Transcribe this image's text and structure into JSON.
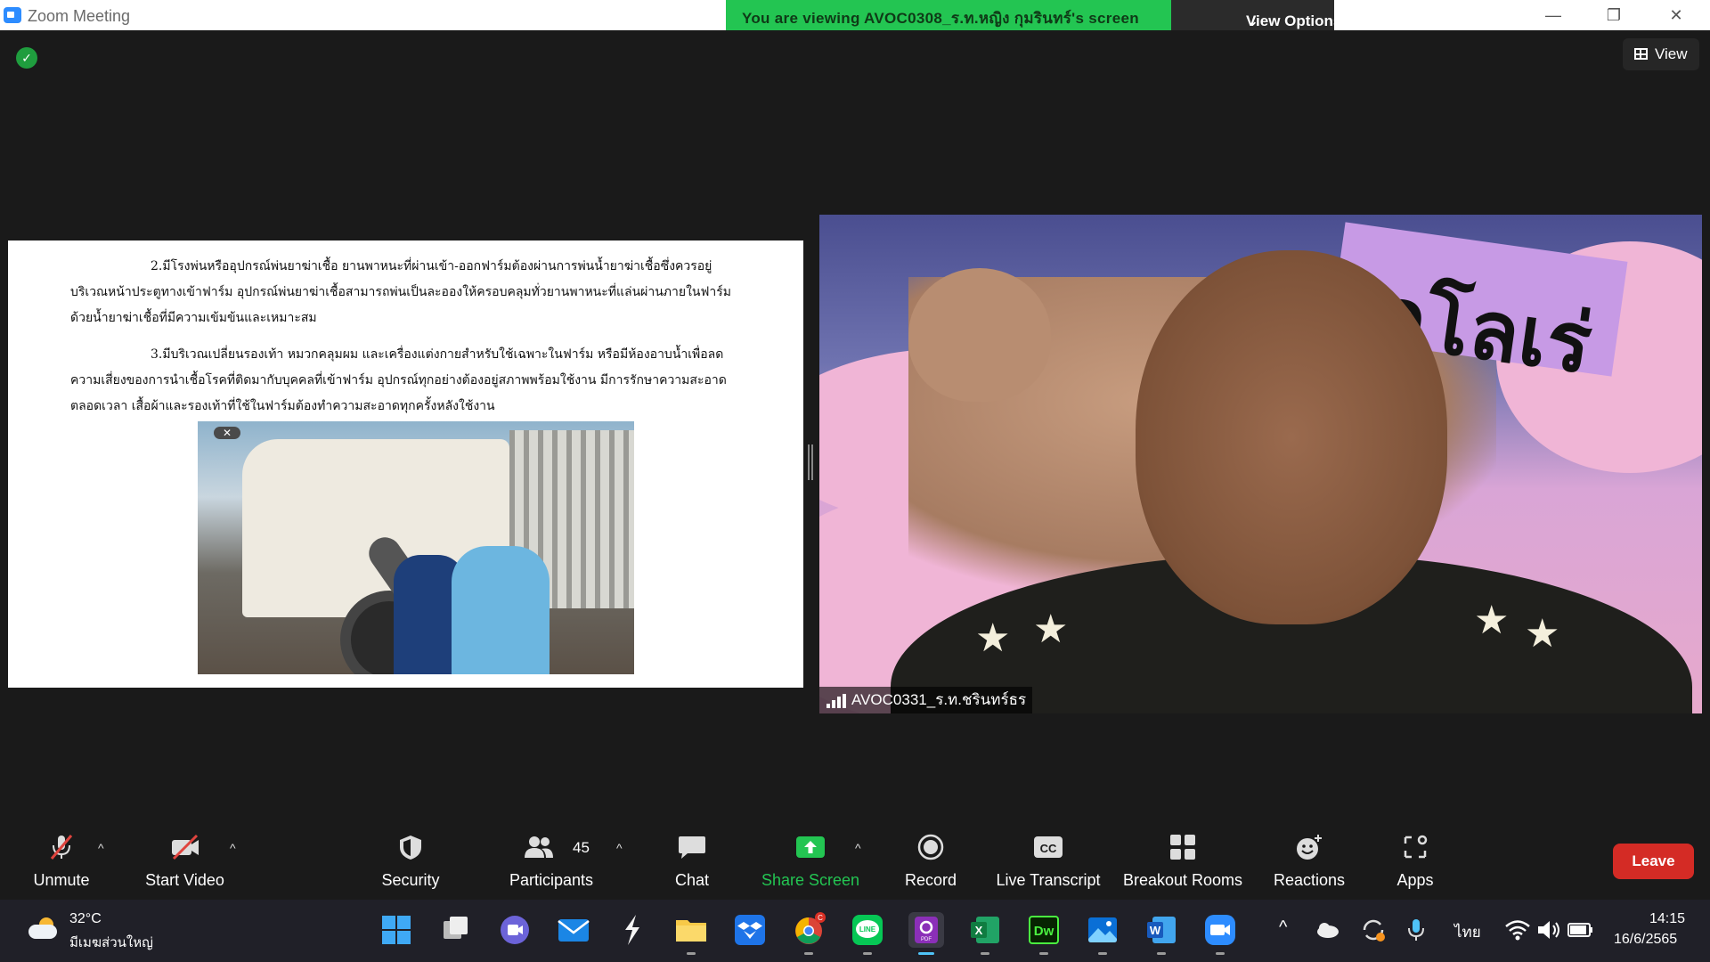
{
  "titlebar": {
    "title": "Zoom Meeting",
    "viewing_banner": "You are viewing AVOC0308_ร.ท.หญิง กุมรินทร์'s screen",
    "view_options": "View Options",
    "minimize": "—",
    "restore": "❐",
    "close": "✕"
  },
  "top": {
    "view_label": "View"
  },
  "document": {
    "lines": [
      "2.มีโรงพ่นหรืออุปกรณ์พ่นยาฆ่าเชื้อ ยานพาหนะที่ผ่านเข้า-ออกฟาร์มต้องผ่านการพ่นน้ำยาฆ่าเชื้อซึ่งควรอยู่",
      "บริเวณหน้าประตูทางเข้าฟาร์ม อุปกรณ์พ่นยาฆ่าเชื้อสามารถพ่นเป็นละอองให้ครอบคลุมทั่วยานพาหนะที่แล่นผ่านภายในฟาร์ม",
      "ด้วยน้ำยาฆ่าเชื้อที่มีความเข้มข้นและเหมาะสม",
      "3.มีบริเวณเปลี่ยนรองเท้า หมวกคลุมผม และเครื่องแต่งกายสำหรับใช้เฉพาะในฟาร์ม หรือมีห้องอาบน้ำเพื่อลด",
      "ความเสี่ยงของการนำเชื้อโรคที่ติดมากับบุคคลที่เข้าฟาร์ม อุปกรณ์ทุกอย่างต้องอยู่สภาพพร้อมใช้งาน มีการรักษาความสะอาด",
      "ตลอดเวลา เสื้อผ้าและรองเท้าที่ใช้ในฟาร์มต้องทำความสะอาดทุกครั้งหลังใช้งาน"
    ]
  },
  "video": {
    "participant_name": "AVOC0331_ร.ท.ชรินทร์ธร",
    "background_text": "กโลเร่"
  },
  "toolbar": {
    "unmute": "Unmute",
    "start_video": "Start Video",
    "security": "Security",
    "participants": "Participants",
    "participant_count": "45",
    "chat": "Chat",
    "share_screen": "Share Screen",
    "record": "Record",
    "live_transcript": "Live Transcript",
    "live_transcript_icon_text": "CC",
    "breakout_rooms": "Breakout Rooms",
    "reactions": "Reactions",
    "apps": "Apps",
    "leave": "Leave",
    "share_color": "#23c552",
    "leave_color": "#d42b25"
  },
  "taskbar": {
    "temperature": "32°C",
    "weather_desc": "มีเมฆส่วนใหญ่",
    "language": "ไทย",
    "time": "14:15",
    "date": "16/6/2565",
    "chrome_badge": "C",
    "dw_label": "Dw",
    "word_label": "W",
    "excel_label": "X",
    "pdf_label": "PDF",
    "line_label": "LINE"
  }
}
